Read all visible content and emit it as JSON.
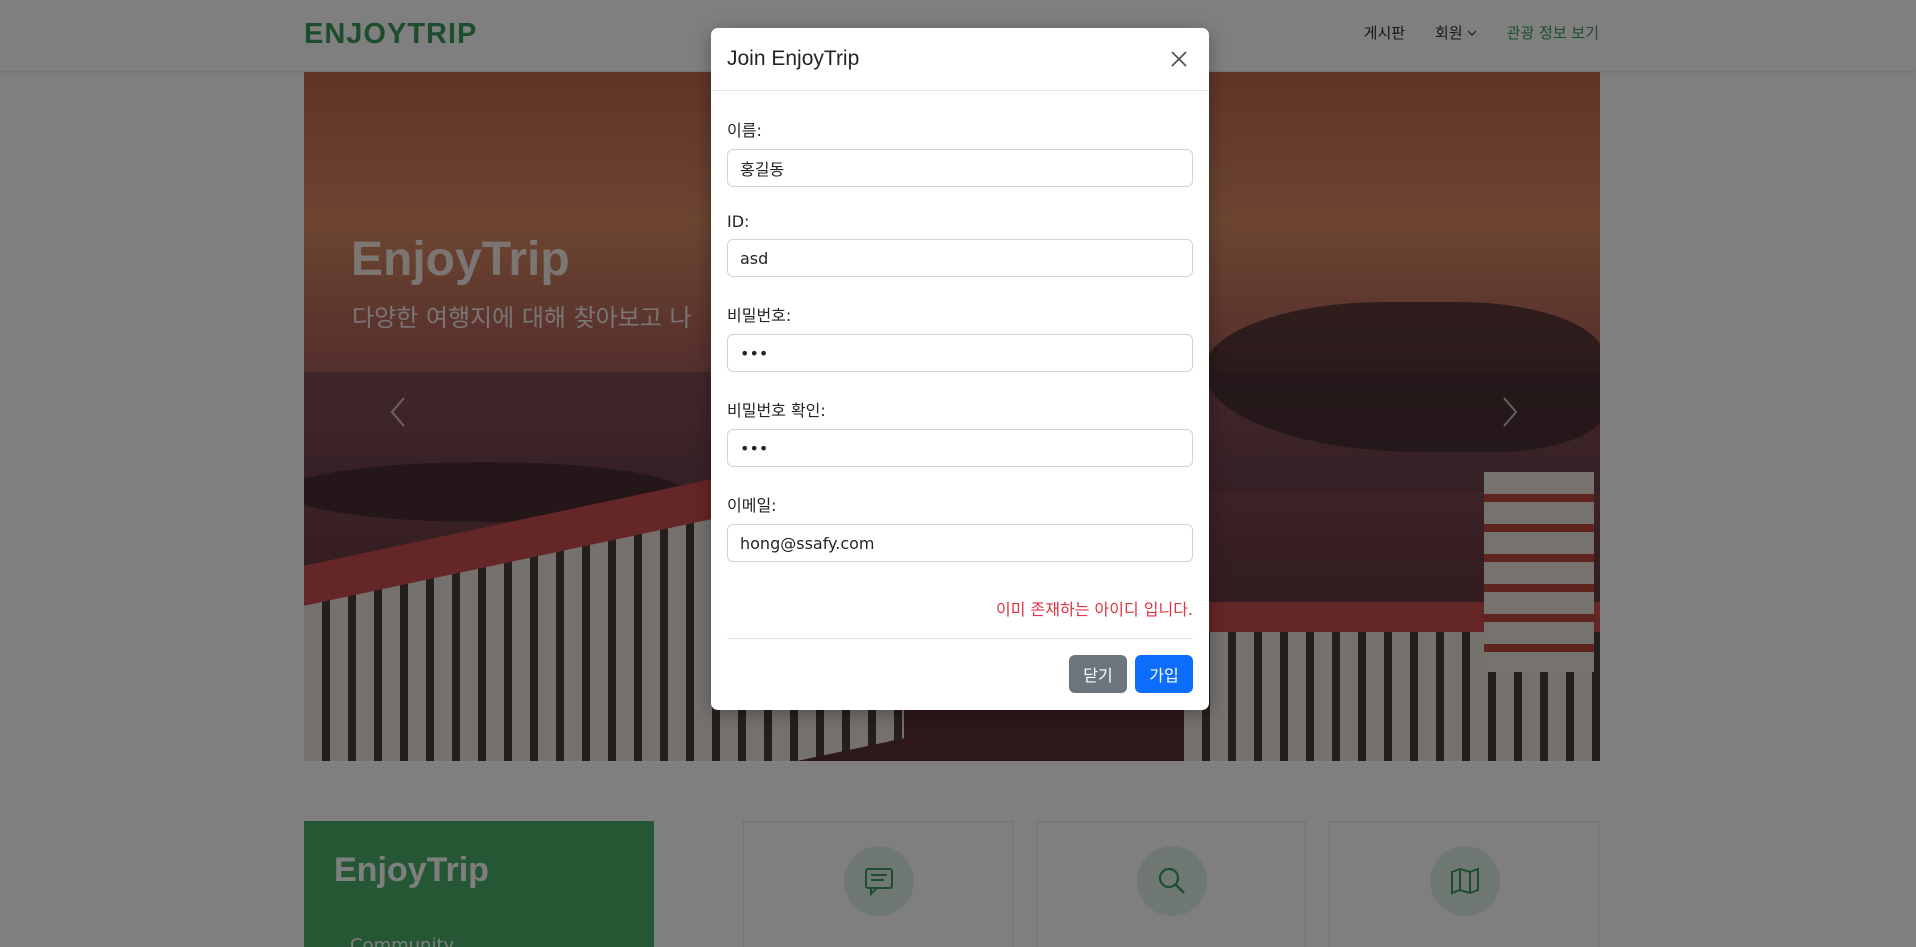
{
  "navbar": {
    "logo": "ENJOYTRIP",
    "items": [
      {
        "label": "게시판"
      },
      {
        "label": "회원"
      },
      {
        "label": "관광 정보 보기"
      }
    ]
  },
  "hero": {
    "title": "EnjoyTrip",
    "subtitle": "다양한 여행지에 대해 찾아보고 나"
  },
  "cards": {
    "green_title": "EnjoyTrip",
    "green_sub": "Community",
    "icons": [
      "chat-icon",
      "search-icon",
      "map-icon"
    ]
  },
  "modal": {
    "title": "Join EnjoyTrip",
    "fields": [
      {
        "label": "이름:",
        "value": "홍길동",
        "type": "text"
      },
      {
        "label": "ID:",
        "value": "asd",
        "type": "text"
      },
      {
        "label": "비밀번호:",
        "value": "asd",
        "type": "password"
      },
      {
        "label": "비밀번호 확인:",
        "value": "asd",
        "type": "password"
      },
      {
        "label": "이메일:",
        "value": "hong@ssafy.com",
        "type": "email"
      }
    ],
    "error_message": "이미 존재하는 아이디 입니다.",
    "close_label": "닫기",
    "submit_label": "가입"
  },
  "colors": {
    "brand_green": "#3d9b5a",
    "error_red": "#dc3545",
    "primary_blue": "#0d6efd",
    "secondary_gray": "#6c757d"
  }
}
